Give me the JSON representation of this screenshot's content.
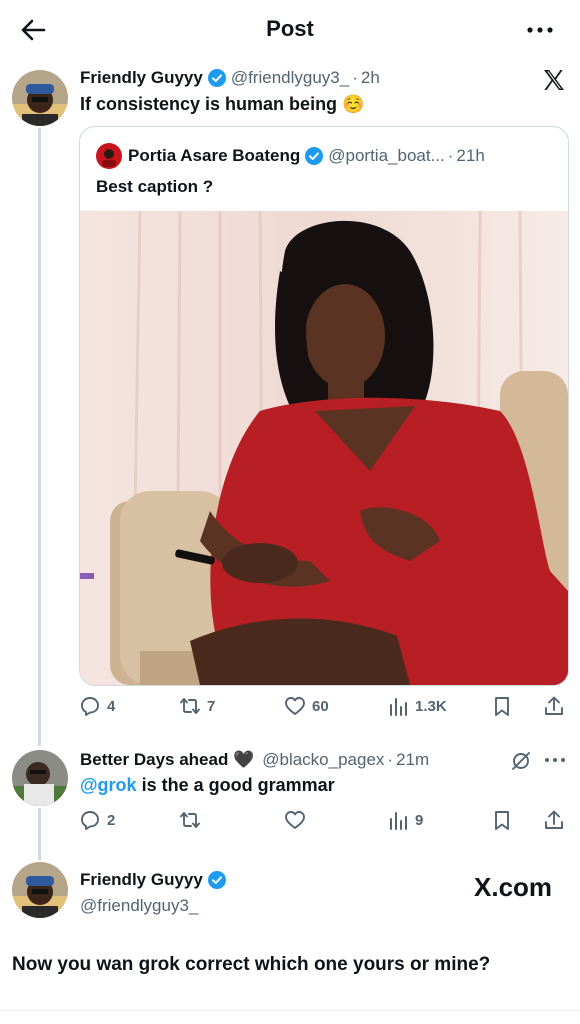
{
  "header": {
    "title": "Post",
    "back_icon": "arrow-left-icon",
    "more_icon": "more-horizontal-icon"
  },
  "colors": {
    "verified": "#1d9bf0",
    "link": "#1d9bf0",
    "muted": "#536471",
    "thread_line": "#cfd9de"
  },
  "main_post": {
    "name": "Friendly Guyyy",
    "handle": "@friendlyguy3_",
    "dot": "·",
    "time": "2h",
    "text": "If consistency is human being ☺️",
    "quote": {
      "name": "Portia Asare Boateng",
      "handle": "@portia_boat...",
      "dot": "·",
      "time": "21h",
      "text": "Best caption ?"
    },
    "stats": {
      "replies": "4",
      "reposts": "7",
      "likes": "60",
      "views": "1.3K"
    }
  },
  "reply_post": {
    "name": "Better Days ahead 🖤",
    "handle": "@blacko_pagex",
    "dot": "·",
    "time": "21m",
    "mention": "@grok",
    "text": " is the a good grammar",
    "stats": {
      "replies": "2",
      "reposts": "",
      "likes": "",
      "views": "9"
    }
  },
  "composer_post": {
    "name": "Friendly Guyyy",
    "handle": "@friendlyguy3_",
    "brand": "X.com",
    "text": "Now you wan grok correct which one yours or mine?"
  }
}
